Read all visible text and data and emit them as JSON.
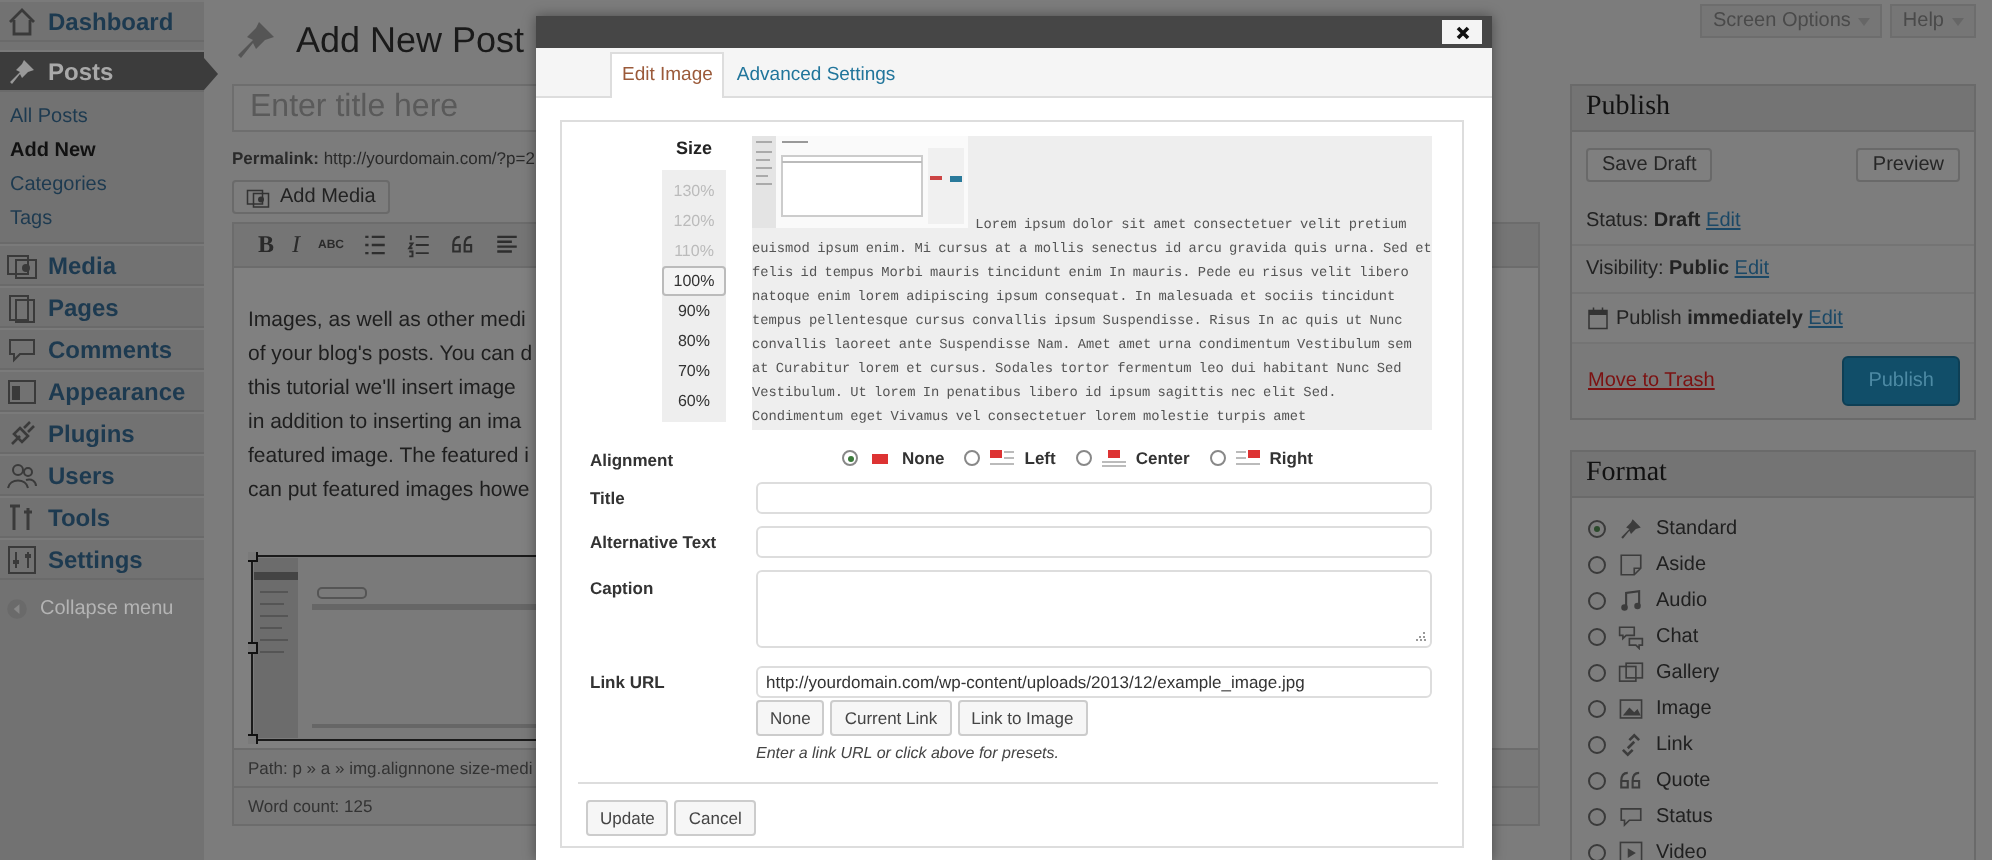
{
  "admin_menu": {
    "items": [
      {
        "kind": "dashboard",
        "label": "Dashboard",
        "selected": false
      },
      {
        "kind": "posts",
        "label": "Posts",
        "selected": true,
        "children": [
          {
            "label": "All Posts",
            "selected": false
          },
          {
            "label": "Add New",
            "selected": true
          },
          {
            "label": "Categories",
            "selected": false
          },
          {
            "label": "Tags",
            "selected": false
          }
        ]
      },
      {
        "kind": "media",
        "label": "Media",
        "selected": false
      },
      {
        "kind": "pages",
        "label": "Pages",
        "selected": false
      },
      {
        "kind": "comments",
        "label": "Comments",
        "selected": false
      },
      {
        "kind": "appearance",
        "label": "Appearance",
        "selected": false
      },
      {
        "kind": "plugins",
        "label": "Plugins",
        "selected": false
      },
      {
        "kind": "users",
        "label": "Users",
        "selected": false
      },
      {
        "kind": "tools",
        "label": "Tools",
        "selected": false
      },
      {
        "kind": "settings",
        "label": "Settings",
        "selected": false
      }
    ],
    "collapse": "Collapse menu"
  },
  "header": {
    "title": "Add New Post",
    "screen_options": "Screen Options",
    "help": "Help"
  },
  "editor": {
    "title_placeholder": "Enter title here",
    "permalink_label": "Permalink:",
    "permalink_url": "http://yourdomain.com/?p=2",
    "add_media": "Add Media",
    "toolbar": [
      {
        "kind": "bold",
        "label": "B"
      },
      {
        "kind": "italic",
        "label": "I"
      },
      {
        "kind": "strike",
        "label": "ABC"
      },
      {
        "kind": "bullets"
      },
      {
        "kind": "numbers"
      },
      {
        "kind": "quote"
      },
      {
        "kind": "align"
      }
    ],
    "content_lines": [
      "Images, as well as other medi",
      "of your blog's posts. You can d",
      "this tutorial we'll insert image",
      "in addition to inserting an ima",
      "featured image. The featured i",
      "can put featured images howe"
    ],
    "path": "Path: p » a » img.alignnone size-medi",
    "word_count": "Word count: 125"
  },
  "publish": {
    "title": "Publish",
    "save_draft": "Save Draft",
    "preview": "Preview",
    "rows": [
      {
        "kind": "status",
        "label": "Status:",
        "value": "Draft",
        "edit": "Edit"
      },
      {
        "kind": "visibility",
        "label": "Visibility:",
        "value": "Public",
        "edit": "Edit"
      },
      {
        "kind": "schedule",
        "label": "Publish",
        "value": "immediately",
        "edit": "Edit"
      }
    ],
    "trash": "Move to Trash",
    "publish": "Publish"
  },
  "format": {
    "title": "Format",
    "options": [
      {
        "kind": "standard",
        "label": "Standard",
        "selected": true
      },
      {
        "kind": "aside",
        "label": "Aside",
        "selected": false
      },
      {
        "kind": "audio",
        "label": "Audio",
        "selected": false
      },
      {
        "kind": "chat",
        "label": "Chat",
        "selected": false
      },
      {
        "kind": "gallery",
        "label": "Gallery",
        "selected": false
      },
      {
        "kind": "image",
        "label": "Image",
        "selected": false
      },
      {
        "kind": "link",
        "label": "Link",
        "selected": false
      },
      {
        "kind": "quote",
        "label": "Quote",
        "selected": false
      },
      {
        "kind": "status",
        "label": "Status",
        "selected": false
      },
      {
        "kind": "video",
        "label": "Video",
        "selected": false
      }
    ]
  },
  "modal": {
    "tabs": [
      {
        "label": "Edit Image",
        "selected": true
      },
      {
        "label": "Advanced Settings",
        "selected": false
      }
    ],
    "size_label": "Size",
    "sizes": [
      {
        "label": "130%",
        "selected": false,
        "disabled": true
      },
      {
        "label": "120%",
        "selected": false,
        "disabled": true
      },
      {
        "label": "110%",
        "selected": false,
        "disabled": true
      },
      {
        "label": "100%",
        "selected": true,
        "disabled": false
      },
      {
        "label": "90%",
        "selected": false,
        "disabled": false
      },
      {
        "label": "80%",
        "selected": false,
        "disabled": false
      },
      {
        "label": "70%",
        "selected": false,
        "disabled": false
      },
      {
        "label": "60%",
        "selected": false,
        "disabled": false
      }
    ],
    "preview_text": "Lorem ipsum dolor sit amet consectetuer velit pretium euismod ipsum enim. Mi cursus at a mollis senectus id arcu gravida quis urna. Sed et felis id tempus Morbi mauris tincidunt enim In mauris. Pede eu risus velit libero natoque enim lorem adipiscing ipsum consequat. In malesuada et sociis tincidunt tempus pellentesque cursus convallis ipsum Suspendisse. Risus In ac quis ut Nunc convallis laoreet ante Suspendisse Nam. Amet amet urna condimentum Vestibulum sem at Curabitur lorem et cursus. Sodales tortor fermentum leo dui habitant Nunc Sed Vestibulum. Ut lorem In penatibus libero id ipsum sagittis nec elit Sed. Condimentum eget Vivamus vel consectetuer lorem molestie turpis amet",
    "alignment_label": "Alignment",
    "alignments": [
      {
        "kind": "none",
        "label": "None",
        "selected": true
      },
      {
        "kind": "left",
        "label": "Left",
        "selected": false
      },
      {
        "kind": "center",
        "label": "Center",
        "selected": false
      },
      {
        "kind": "right",
        "label": "Right",
        "selected": false
      }
    ],
    "fields": [
      {
        "kind": "input",
        "label": "Title"
      },
      {
        "kind": "input",
        "label": "Alternative Text"
      },
      {
        "kind": "textarea",
        "label": "Caption"
      },
      {
        "kind": "input",
        "label": "Link URL",
        "value": "http://yourdomain.com/wp-content/uploads/2013/12/example_image.jpg"
      }
    ],
    "link_buttons": [
      "None",
      "Current Link",
      "Link to Image"
    ],
    "hint": "Enter a link URL or click above for presets.",
    "buttons": [
      "Update",
      "Cancel"
    ]
  }
}
